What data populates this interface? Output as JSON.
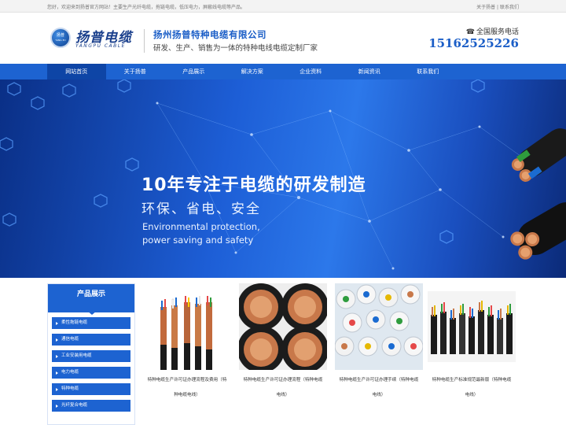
{
  "topbar": {
    "welcome": "您好，欢迎来到扬普官方网站！主要生产光纤电缆，拖链电缆，低压电力，屏蔽线电缆等产品。",
    "links": [
      "关于扬普",
      "联系我们"
    ],
    "separator": "|"
  },
  "header": {
    "logo_badge": "扬普",
    "logo_badge_en": "YANG PU",
    "logo_cn": "扬普电缆",
    "logo_en": "YANGPU CABLE",
    "company_name": "扬州扬普特种电缆有限公司",
    "slogan": "研发、生产、销售为一体的特种电线电缆定制厂家",
    "hotline_label": "全国服务电话",
    "hotline_number": "15162525226"
  },
  "nav": {
    "items": [
      "网站首页",
      "关于扬普",
      "产品展示",
      "解决方案",
      "企业资料",
      "新闻资讯",
      "联系我们"
    ],
    "active_index": 0
  },
  "banner": {
    "title": "10年专注于电缆的研发制造",
    "subtitle": "环保、省电、安全",
    "en_line1": "Environmental protection,",
    "en_line2": "power saving and safety"
  },
  "sidebar": {
    "title": "产品展示",
    "items": [
      "柔性拖链电缆",
      "通信电缆",
      "工业安装用电缆",
      "电力电缆",
      "特种电缆",
      "光纤复合电缆"
    ]
  },
  "products": [
    {
      "caption_l1": "特种电缆生产许可证办理流程及费用（特",
      "caption_l2": "种电缆电线）"
    },
    {
      "caption_l1": "特种电缆生产许可证办理流程（特种电缆",
      "caption_l2": "电线）"
    },
    {
      "caption_l1": "特种电缆生产许可证办理手续（特种电缆",
      "caption_l2": "电线）"
    },
    {
      "caption_l1": "特种电缆生产标准规范最新版（特种电缆",
      "caption_l2": "电线）"
    }
  ],
  "colors": {
    "brand_blue": "#1d63d1",
    "nav_active": "#0e45a6",
    "banner_blue": "#1d5ed6",
    "copper": "#c8784a"
  },
  "icons": {
    "hotline": "phone-icon",
    "sidebar_bullet": "triangle-right-icon"
  }
}
